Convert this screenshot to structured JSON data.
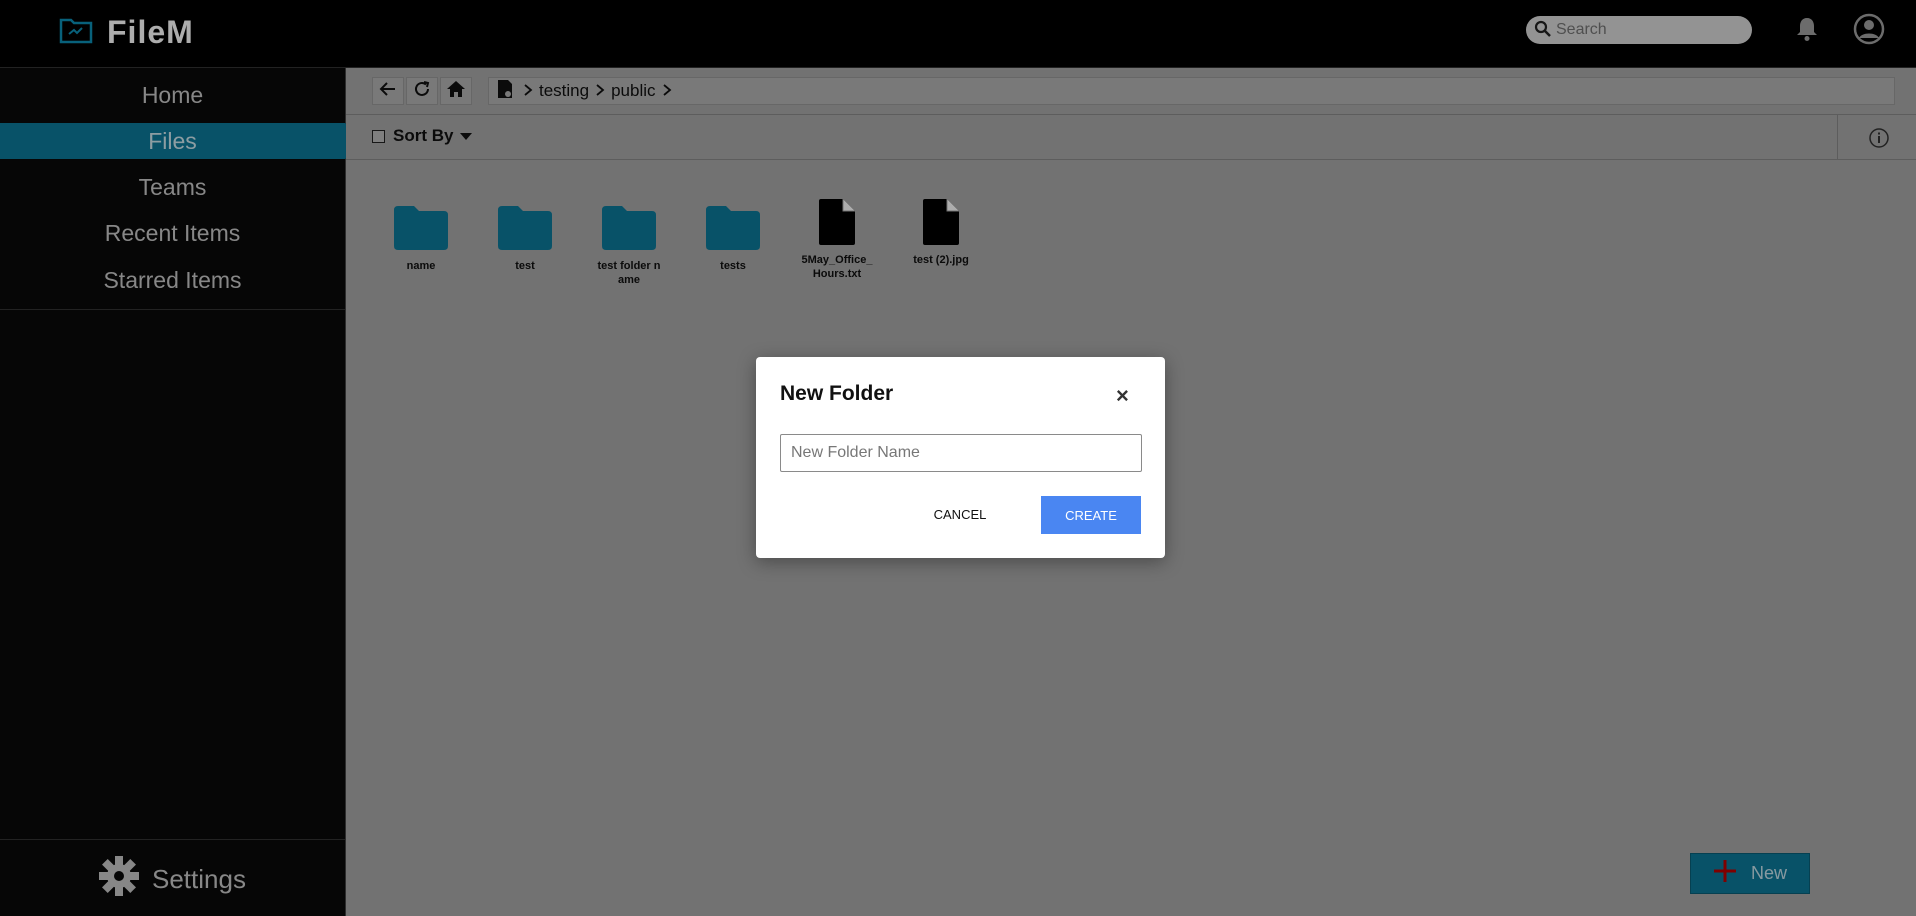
{
  "app": {
    "brand": "FileM"
  },
  "search": {
    "placeholder": "Search"
  },
  "sidebar": {
    "items": [
      {
        "label": "Home"
      },
      {
        "label": "Files"
      },
      {
        "label": "Teams"
      },
      {
        "label": "Recent Items"
      },
      {
        "label": "Starred Items"
      }
    ],
    "settings_label": "Settings"
  },
  "breadcrumb": [
    "testing",
    "public"
  ],
  "sortbar": {
    "label": "Sort By"
  },
  "files": [
    {
      "name": "name",
      "type": "folder"
    },
    {
      "name": "test",
      "type": "folder"
    },
    {
      "name": "test folder name",
      "type": "folder"
    },
    {
      "name": "tests",
      "type": "folder"
    },
    {
      "name": "5May_Office_Hours.txt",
      "type": "file"
    },
    {
      "name": "test (2).jpg",
      "type": "file"
    }
  ],
  "new_button": {
    "label": "New"
  },
  "dialog": {
    "title": "New Folder",
    "close_glyph": "×",
    "input_placeholder": "New Folder Name",
    "input_value": "",
    "cancel_label": "CANCEL",
    "create_label": "CREATE"
  },
  "colors": {
    "accent": "#0d7a9a",
    "create_button": "#4a86f2",
    "topbar": "#000000",
    "sidebar": "#0a0a0a"
  },
  "icons": [
    "logo-icon",
    "search-icon",
    "bell-icon",
    "user-avatar-icon",
    "back-arrow-icon",
    "refresh-icon",
    "home-icon",
    "drive-icon",
    "chevron-right-icon",
    "caret-down-icon",
    "info-icon",
    "folder-icon",
    "file-icon",
    "plus-icon",
    "gear-icon",
    "close-icon"
  ]
}
